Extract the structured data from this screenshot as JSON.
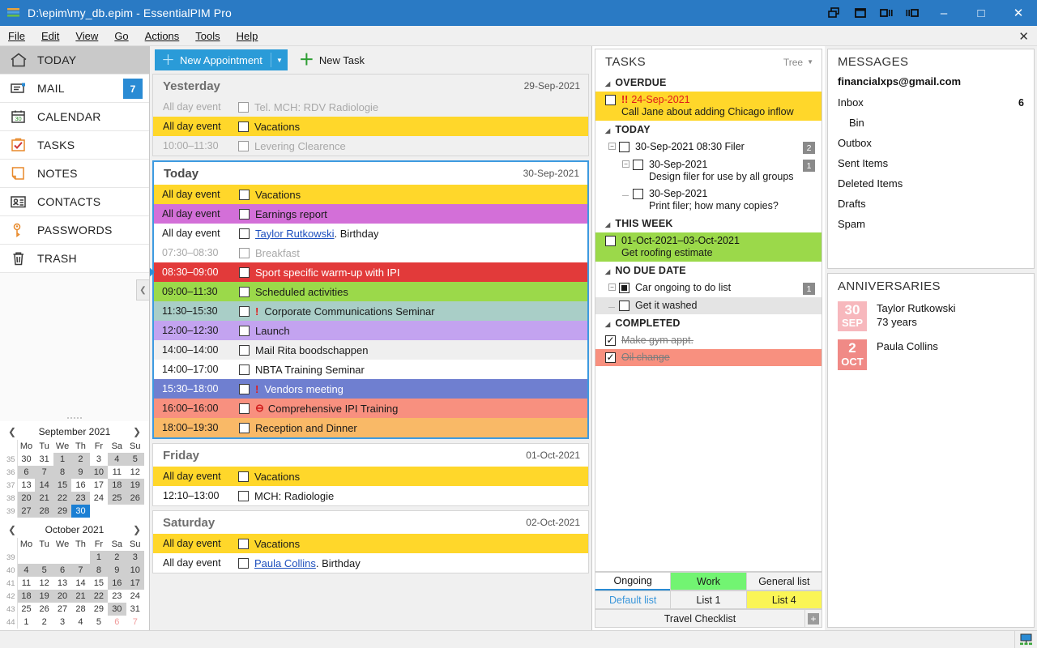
{
  "window": {
    "title": "D:\\epim\\my_db.epim - EssentialPIM Pro",
    "app_icon": "epim-logo-icon",
    "layout_buttons": [
      "layout-cascade-icon",
      "layout-single-icon",
      "layout-two-pane-icon",
      "layout-three-pane-icon"
    ],
    "minimize": "–",
    "maximize": "□",
    "close": "✕"
  },
  "menu": {
    "items": [
      "File",
      "Edit",
      "View",
      "Go",
      "Actions",
      "Tools",
      "Help"
    ],
    "close_label": "✕"
  },
  "sidebar": {
    "items": [
      {
        "label": "TODAY",
        "icon": "home-icon",
        "active": true,
        "badge": ""
      },
      {
        "label": "MAIL",
        "icon": "mail-icon",
        "active": false,
        "badge": "7"
      },
      {
        "label": "CALENDAR",
        "icon": "calendar-icon",
        "active": false,
        "badge": ""
      },
      {
        "label": "TASKS",
        "icon": "checklist-icon",
        "active": false,
        "badge": ""
      },
      {
        "label": "NOTES",
        "icon": "note-icon",
        "active": false,
        "badge": ""
      },
      {
        "label": "CONTACTS",
        "icon": "contact-card-icon",
        "active": false,
        "badge": ""
      },
      {
        "label": "PASSWORDS",
        "icon": "key-icon",
        "active": false,
        "badge": ""
      },
      {
        "label": "TRASH",
        "icon": "trash-icon",
        "active": false,
        "badge": ""
      }
    ],
    "collapse_label": "❮"
  },
  "calendars": [
    {
      "name": "september-2021",
      "title": "September  2021",
      "prev": "❮",
      "next": "❯",
      "daynames": [
        "Mo",
        "Tu",
        "We",
        "Th",
        "Fr",
        "Sa",
        "Su"
      ],
      "weeks": [
        {
          "wk": "35",
          "days": [
            {
              "n": "30",
              "cls": "out"
            },
            {
              "n": "31",
              "cls": "out"
            },
            {
              "n": "1",
              "cls": "hl"
            },
            {
              "n": "2",
              "cls": "hl"
            },
            {
              "n": "3",
              "cls": ""
            },
            {
              "n": "4",
              "cls": "hl we"
            },
            {
              "n": "5",
              "cls": "hl we"
            }
          ]
        },
        {
          "wk": "36",
          "days": [
            {
              "n": "6",
              "cls": "hl"
            },
            {
              "n": "7",
              "cls": "hl"
            },
            {
              "n": "8",
              "cls": "hl"
            },
            {
              "n": "9",
              "cls": "hl"
            },
            {
              "n": "10",
              "cls": "hl"
            },
            {
              "n": "11",
              "cls": "we"
            },
            {
              "n": "12",
              "cls": "we"
            }
          ]
        },
        {
          "wk": "37",
          "days": [
            {
              "n": "13",
              "cls": ""
            },
            {
              "n": "14",
              "cls": "hl"
            },
            {
              "n": "15",
              "cls": "hl"
            },
            {
              "n": "16",
              "cls": ""
            },
            {
              "n": "17",
              "cls": ""
            },
            {
              "n": "18",
              "cls": "hl we"
            },
            {
              "n": "19",
              "cls": "hl we"
            }
          ]
        },
        {
          "wk": "38",
          "days": [
            {
              "n": "20",
              "cls": "hl"
            },
            {
              "n": "21",
              "cls": "hl"
            },
            {
              "n": "22",
              "cls": "hl"
            },
            {
              "n": "23",
              "cls": "hl"
            },
            {
              "n": "24",
              "cls": ""
            },
            {
              "n": "25",
              "cls": "hl we"
            },
            {
              "n": "26",
              "cls": "hl we"
            }
          ]
        },
        {
          "wk": "39",
          "days": [
            {
              "n": "27",
              "cls": "hl"
            },
            {
              "n": "28",
              "cls": "hl"
            },
            {
              "n": "29",
              "cls": "hl"
            },
            {
              "n": "30",
              "cls": "sel"
            },
            {
              "n": "",
              "cls": ""
            },
            {
              "n": "",
              "cls": ""
            },
            {
              "n": "",
              "cls": ""
            }
          ]
        }
      ]
    },
    {
      "name": "october-2021",
      "title": "October  2021",
      "prev": "❮",
      "next": "❯",
      "daynames": [
        "Mo",
        "Tu",
        "We",
        "Th",
        "Fr",
        "Sa",
        "Su"
      ],
      "weeks": [
        {
          "wk": "39",
          "days": [
            {
              "n": "",
              "cls": ""
            },
            {
              "n": "",
              "cls": ""
            },
            {
              "n": "",
              "cls": ""
            },
            {
              "n": "",
              "cls": ""
            },
            {
              "n": "1",
              "cls": "hl"
            },
            {
              "n": "2",
              "cls": "hl we"
            },
            {
              "n": "3",
              "cls": "hl we"
            }
          ]
        },
        {
          "wk": "40",
          "days": [
            {
              "n": "4",
              "cls": "hl"
            },
            {
              "n": "5",
              "cls": "hl"
            },
            {
              "n": "6",
              "cls": "hl"
            },
            {
              "n": "7",
              "cls": "hl"
            },
            {
              "n": "8",
              "cls": "hl"
            },
            {
              "n": "9",
              "cls": "hl we"
            },
            {
              "n": "10",
              "cls": "hl we"
            }
          ]
        },
        {
          "wk": "41",
          "days": [
            {
              "n": "11",
              "cls": ""
            },
            {
              "n": "12",
              "cls": ""
            },
            {
              "n": "13",
              "cls": ""
            },
            {
              "n": "14",
              "cls": ""
            },
            {
              "n": "15",
              "cls": ""
            },
            {
              "n": "16",
              "cls": "hl we"
            },
            {
              "n": "17",
              "cls": "hl we"
            }
          ]
        },
        {
          "wk": "42",
          "days": [
            {
              "n": "18",
              "cls": "hl"
            },
            {
              "n": "19",
              "cls": "hl"
            },
            {
              "n": "20",
              "cls": "hl"
            },
            {
              "n": "21",
              "cls": "hl"
            },
            {
              "n": "22",
              "cls": "hl"
            },
            {
              "n": "23",
              "cls": "we"
            },
            {
              "n": "24",
              "cls": "we"
            }
          ]
        },
        {
          "wk": "43",
          "days": [
            {
              "n": "25",
              "cls": ""
            },
            {
              "n": "26",
              "cls": ""
            },
            {
              "n": "27",
              "cls": ""
            },
            {
              "n": "28",
              "cls": ""
            },
            {
              "n": "29",
              "cls": ""
            },
            {
              "n": "30",
              "cls": "hl we"
            },
            {
              "n": "31",
              "cls": "we"
            }
          ]
        },
        {
          "wk": "44",
          "days": [
            {
              "n": "1",
              "cls": "out"
            },
            {
              "n": "2",
              "cls": "out"
            },
            {
              "n": "3",
              "cls": "out"
            },
            {
              "n": "4",
              "cls": "out"
            },
            {
              "n": "5",
              "cls": "out"
            },
            {
              "n": "6",
              "cls": "out we"
            },
            {
              "n": "7",
              "cls": "out we"
            }
          ]
        }
      ]
    }
  ],
  "toolbar": {
    "new_appointment": "New Appointment",
    "new_appointment_plus": "＋",
    "dropdown_caret": "▼",
    "new_task": "New Task",
    "new_task_plus": "＋"
  },
  "days": [
    {
      "name": "Yesterday",
      "date": "29-Sep-2021",
      "state": "past",
      "events": [
        {
          "time": "All day event",
          "title": "Tel. MCH: RDV Radiologie",
          "color": "",
          "dim": true,
          "flag": "",
          "person": ""
        },
        {
          "time": "All day event",
          "title": "Vacations",
          "color": "#ffd72a",
          "dim": false,
          "flag": "",
          "person": ""
        },
        {
          "time": "10:00–11:30",
          "title": "Levering Clearence",
          "color": "",
          "dim": true,
          "flag": "",
          "person": ""
        }
      ]
    },
    {
      "name": "Today",
      "date": "30-Sep-2021",
      "state": "today",
      "events": [
        {
          "time": "All day event",
          "title": "Vacations",
          "color": "#ffd72a",
          "dim": false,
          "flag": "",
          "person": ""
        },
        {
          "time": "All day event",
          "title": "Earnings report",
          "color": "#d36fd8",
          "dim": false,
          "flag": "",
          "person": ""
        },
        {
          "time": "All day event",
          "title": ". Birthday",
          "color": "",
          "dim": false,
          "flag": "",
          "person": "Taylor Rutkowski"
        },
        {
          "time": "07:30–08:30",
          "title": "Breakfast",
          "color": "",
          "dim": true,
          "flag": "",
          "person": ""
        },
        {
          "time": "08:30–09:00",
          "title": "Sport specific warm-up with IPI",
          "color": "#e23a3a",
          "dim": false,
          "flag": "",
          "person": "",
          "now": true
        },
        {
          "time": "09:00–11:30",
          "title": "Scheduled activities",
          "color": "#9bd94a",
          "dim": false,
          "flag": "",
          "person": ""
        },
        {
          "time": "11:30–15:30",
          "title": "Corporate Communications Seminar",
          "color": "#a9cec7",
          "dim": false,
          "flag": "!",
          "person": ""
        },
        {
          "time": "12:00–12:30",
          "title": "Launch",
          "color": "#c3a3f0",
          "dim": false,
          "flag": "",
          "person": ""
        },
        {
          "time": "14:00–14:00",
          "title": "Mail Rita boodschappen",
          "color": "#efefef",
          "dim": false,
          "flag": "",
          "person": ""
        },
        {
          "time": "14:00–17:00",
          "title": "NBTA Training Seminar",
          "color": "",
          "dim": false,
          "flag": "",
          "person": ""
        },
        {
          "time": "15:30–18:00",
          "title": "Vendors meeting",
          "color": "#6f7fd0",
          "dim": false,
          "flag": "!",
          "person": ""
        },
        {
          "time": "16:00–16:00",
          "title": "Comprehensive IPI Training",
          "color": "#f8907f",
          "dim": false,
          "flag": "⊖",
          "person": ""
        },
        {
          "time": "18:00–19:30",
          "title": "Reception and Dinner",
          "color": "#f9b967",
          "dim": false,
          "flag": "",
          "person": ""
        }
      ]
    },
    {
      "name": "Friday",
      "date": "01-Oct-2021",
      "state": "future",
      "events": [
        {
          "time": "All day event",
          "title": "Vacations",
          "color": "#ffd72a",
          "dim": false,
          "flag": "",
          "person": ""
        },
        {
          "time": "12:10–13:00",
          "title": "MCH: Radiologie",
          "color": "",
          "dim": false,
          "flag": "",
          "person": ""
        }
      ]
    },
    {
      "name": "Saturday",
      "date": "02-Oct-2021",
      "state": "future",
      "events": [
        {
          "time": "All day event",
          "title": "Vacations",
          "color": "#ffd72a",
          "dim": false,
          "flag": "",
          "person": ""
        },
        {
          "time": "All day event",
          "title": ". Birthday",
          "color": "",
          "dim": false,
          "flag": "",
          "person": "Paula Collins"
        }
      ]
    }
  ],
  "tasks": {
    "title": "TASKS",
    "view_mode": "Tree",
    "view_caret": "▼",
    "groups": [
      {
        "label": "OVERDUE",
        "items": [
          {
            "date": "24-Sep-2021",
            "text": "Call Jane about adding Chicago inflow",
            "priority": "!!",
            "highlight": "hl-yellow",
            "overdue": true,
            "indent": 0,
            "checkbox": "empty",
            "count": "",
            "expander": "",
            "tree": false,
            "done": false
          }
        ]
      },
      {
        "label": "TODAY",
        "items": [
          {
            "date": "30-Sep-2021 08:30 Filer",
            "text": "",
            "priority": "",
            "highlight": "",
            "overdue": false,
            "indent": 0,
            "checkbox": "empty",
            "count": "2",
            "expander": "−",
            "tree": false,
            "done": false
          },
          {
            "date": "30-Sep-2021",
            "text": "Design filer for use by all groups",
            "priority": "",
            "highlight": "",
            "overdue": false,
            "indent": 1,
            "checkbox": "empty",
            "count": "1",
            "expander": "−",
            "tree": false,
            "done": false
          },
          {
            "date": "30-Sep-2021",
            "text": "Print filer; how many copies?",
            "priority": "",
            "highlight": "",
            "overdue": false,
            "indent": 2,
            "checkbox": "empty",
            "count": "",
            "expander": "",
            "tree": true,
            "done": false
          }
        ]
      },
      {
        "label": "THIS WEEK",
        "items": [
          {
            "date": "01-Oct-2021–03-Oct-2021",
            "text": "Get roofing estimate",
            "priority": "",
            "highlight": "hl-green",
            "overdue": false,
            "indent": 0,
            "checkbox": "empty",
            "count": "",
            "expander": "",
            "tree": false,
            "done": false
          }
        ]
      },
      {
        "label": "NO DUE DATE",
        "items": [
          {
            "date": "",
            "text": "Car ongoing to do list",
            "priority": "",
            "highlight": "",
            "overdue": false,
            "indent": 0,
            "checkbox": "filled",
            "count": "1",
            "expander": "−",
            "tree": false,
            "done": false
          },
          {
            "date": "",
            "text": "Get it washed",
            "priority": "",
            "highlight": "hl-grey",
            "overdue": false,
            "indent": 1,
            "checkbox": "empty",
            "count": "",
            "expander": "",
            "tree": true,
            "done": false
          }
        ]
      },
      {
        "label": "COMPLETED",
        "items": [
          {
            "date": "",
            "text": "Make gym appt.",
            "priority": "",
            "highlight": "",
            "overdue": false,
            "indent": 0,
            "checkbox": "checked",
            "count": "",
            "expander": "",
            "tree": false,
            "done": true
          },
          {
            "date": "",
            "text": "Oil change",
            "priority": "",
            "highlight": "hl-red",
            "overdue": false,
            "indent": 0,
            "checkbox": "checked",
            "count": "",
            "expander": "",
            "tree": false,
            "done": true
          }
        ]
      }
    ],
    "tabs_row1": [
      {
        "label": "Ongoing",
        "style": "active"
      },
      {
        "label": "Work",
        "style": "green"
      },
      {
        "label": "General list",
        "style": ""
      }
    ],
    "tabs_row2": [
      {
        "label": "Default list",
        "style": "blue-txt"
      },
      {
        "label": "List 1",
        "style": ""
      },
      {
        "label": "List 4",
        "style": "yellow"
      }
    ],
    "tabs_row3": [
      {
        "label": "Travel Checklist",
        "style": ""
      }
    ],
    "add_tab": "+"
  },
  "messages": {
    "title": "MESSAGES",
    "account": "financialxps@gmail.com",
    "folders": [
      {
        "name": "Inbox",
        "count": "6",
        "sub": false
      },
      {
        "name": "Bin",
        "count": "",
        "sub": true
      },
      {
        "name": "Outbox",
        "count": "",
        "sub": false
      },
      {
        "name": "Sent Items",
        "count": "",
        "sub": false
      },
      {
        "name": "Deleted Items",
        "count": "",
        "sub": false
      },
      {
        "name": "Drafts",
        "count": "",
        "sub": false
      },
      {
        "name": "Spam",
        "count": "",
        "sub": false
      }
    ]
  },
  "anniversaries": {
    "title": "ANNIVERSARIES",
    "items": [
      {
        "day": "30",
        "month": "SEP",
        "name": "Taylor Rutkowski",
        "detail": "73 years",
        "badge_color": "#f7b8bd"
      },
      {
        "day": "2",
        "month": "OCT",
        "name": "Paula Collins",
        "detail": "",
        "badge_color": "#f08a86"
      }
    ]
  },
  "statusbar": {
    "sync_icon": "monitor-network-icon"
  }
}
